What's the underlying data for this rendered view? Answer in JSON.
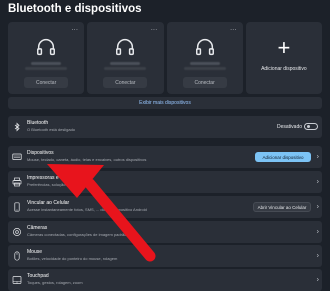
{
  "page": {
    "title": "Bluetooth e dispositivos"
  },
  "devices": [
    {
      "icon": "headphones-icon",
      "name": "Headset BT5",
      "status": "Ocultado",
      "action": "Conectar",
      "more": "..."
    },
    {
      "icon": "headphones-icon",
      "name": "Fone",
      "status": "Ocultado",
      "action": "Conectar",
      "more": "..."
    },
    {
      "icon": "headphones-icon",
      "name": "Redmi Buds 3",
      "status": "Ocultado",
      "action": "Conectar",
      "more": "..."
    }
  ],
  "add_device": {
    "label": "Adicionar dispositivo"
  },
  "show_more": {
    "label": "Exibir mais dispositivos"
  },
  "rows": {
    "bluetooth": {
      "title": "Bluetooth",
      "subtitle": "O Bluetooth está desligado",
      "toggle_label": "Desativado"
    },
    "dispositivos": {
      "title": "Dispositivos",
      "subtitle": "Mouse, teclado, caneta, áudio, telas e encaixes, outros dispositivos",
      "button": "Adicionar dispositivo"
    },
    "impressoras": {
      "title": "Impressoras e sc...",
      "subtitle": "Preferências, solução de..."
    },
    "celular": {
      "title": "Vincular ao Celular",
      "subtitle": "Acesse instantaneamente fotos, SMS, ... do seu dispositivo Android",
      "button": "Abrir Vincular ao Celular"
    },
    "cameras": {
      "title": "Câmeras",
      "subtitle": "Câmeras conectadas, configurações de imagem padrão"
    },
    "mouse": {
      "title": "Mouse",
      "subtitle": "Botões, velocidade do ponteiro do mouse, rolagem"
    },
    "touchpad": {
      "title": "Touchpad",
      "subtitle": "Toques, gestos, rolagem, zoom"
    }
  },
  "colors": {
    "background": "#1c2129",
    "card": "#2a2f38",
    "accent": "#7cc3f5",
    "link": "#99c7ff",
    "arrow": "#e8141c"
  }
}
